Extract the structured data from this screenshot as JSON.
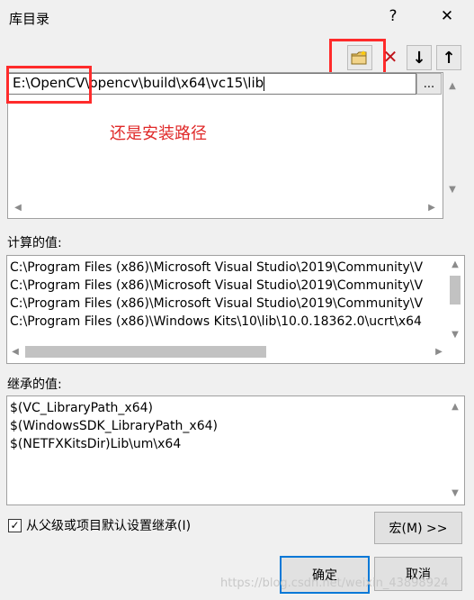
{
  "window": {
    "title": "库目录",
    "help_glyph": "?",
    "close_glyph": "✕"
  },
  "toolbar": {
    "new_line_icon": "folder-new-icon",
    "delete_glyph": "✕",
    "move_down_glyph": "↓",
    "move_up_glyph": "↑"
  },
  "editor": {
    "path_prefix": "E:\\OpenCV",
    "path_sep": "\\",
    "path_rest": "opencv\\build\\x64\\vc15\\lib",
    "browse_label": "...",
    "annotation": "还是安装路径"
  },
  "computed": {
    "label": "计算的值:",
    "rows": [
      "C:\\Program Files (x86)\\Microsoft Visual Studio\\2019\\Community\\V",
      "C:\\Program Files (x86)\\Microsoft Visual Studio\\2019\\Community\\V",
      "C:\\Program Files (x86)\\Microsoft Visual Studio\\2019\\Community\\V",
      "C:\\Program Files (x86)\\Windows Kits\\10\\lib\\10.0.18362.0\\ucrt\\x64"
    ]
  },
  "inherited": {
    "label": "继承的值:",
    "rows": [
      "$(VC_LibraryPath_x64)",
      "$(WindowsSDK_LibraryPath_x64)",
      "$(NETFXKitsDir)Lib\\um\\x64"
    ]
  },
  "inherit_checkbox": {
    "label": "从父级或项目默认设置继承(I)",
    "checked": true,
    "check_glyph": "✓"
  },
  "buttons": {
    "macro": "宏(M) >>",
    "ok": "确定",
    "cancel": "取消"
  },
  "watermark": "https://blog.csdn.net/weixin_43898924"
}
